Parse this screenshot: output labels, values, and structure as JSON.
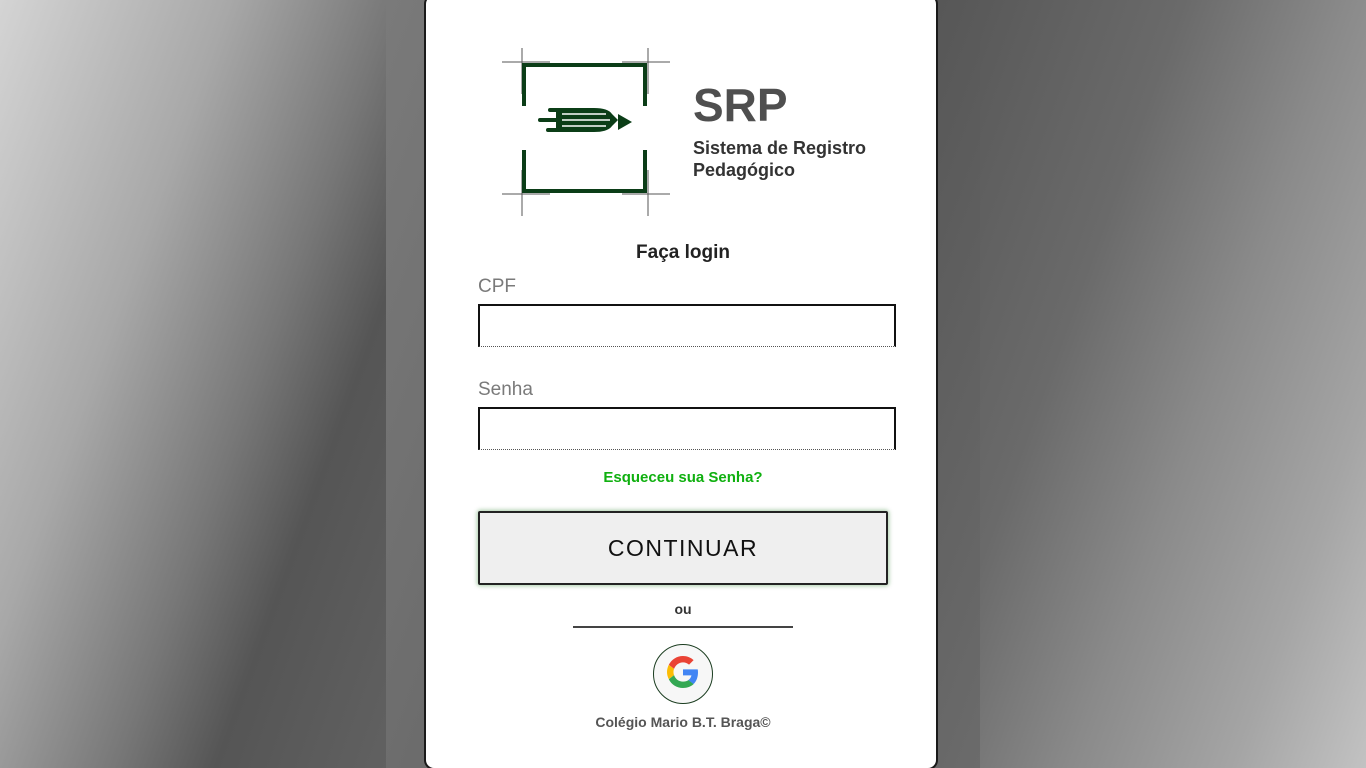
{
  "brand": {
    "title": "SRP",
    "subtitle": "Sistema de Registro Pedagógico"
  },
  "login": {
    "heading": "Faça login",
    "cpf_label": "CPF",
    "cpf_value": "",
    "password_label": "Senha",
    "password_value": "",
    "forgot_password": "Esqueceu sua Senha?",
    "continue_label": "CONTINUAR",
    "or_text": "ou"
  },
  "footer": {
    "text": "Colégio Mario B.T. Braga©"
  },
  "icons": {
    "logo": "pencil-hand-logo-icon",
    "google": "google-icon"
  },
  "colors": {
    "brand_green": "#0b3d17",
    "link_green": "#10b010",
    "title_gray": "#4f4f4f"
  }
}
